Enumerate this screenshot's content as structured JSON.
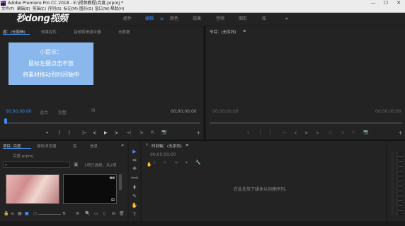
{
  "titlebar": {
    "app_icon_label": "Pr",
    "title": "Adobe Premiere Pro CC 2018 - E:\\视频教程\\百度.prproj *",
    "minimize": "—",
    "maximize": "☐",
    "close": "✕"
  },
  "menubar": {
    "items": [
      "文件(F)",
      "编辑(E)",
      "剪辑(C)",
      "序列(S)",
      "标记(M)",
      "图形(G)",
      "窗口(W)",
      "帮助(H)"
    ]
  },
  "workspace": {
    "tabs": [
      "组件",
      "编辑",
      "颜色",
      "效果",
      "音频",
      "图形",
      "库"
    ],
    "active_index": 1,
    "active_menu_glyph": "≡",
    "more": "»"
  },
  "logo": "秒dong视频",
  "source_panel": {
    "tabs": [
      "源：(无剪辑)",
      "效果控件",
      "音频剪辑混合器",
      "元数据"
    ],
    "timecode_left": "00;00;00;00",
    "fit_label": "适合",
    "fraction": "完整",
    "timecode_right": "00;00;00;00"
  },
  "tip": {
    "title": "小提示：",
    "line1": "鼠标左键点击不放",
    "line2": "将素材拖动到时间轴中"
  },
  "program_panel": {
    "tab": "节目：(无序列)",
    "menu_glyph": "≡",
    "timecode_left": "00;00;00;00",
    "timecode_right": "00;00;00;00"
  },
  "transport": {
    "buttons": [
      "▾",
      "{",
      "}",
      "|←",
      "◂|",
      "▶",
      "|▸",
      "→|",
      "⇲",
      "⇱",
      "📷"
    ],
    "add": "+"
  },
  "project_panel": {
    "tabs": [
      "项目: 百度",
      "媒体浏览器",
      "库",
      "信息"
    ],
    "more": "»",
    "project_file": "百度.prproj",
    "search_placeholder": "",
    "items_selected": "1项已选择，共2项"
  },
  "timeline_panel": {
    "close": "×",
    "tab": "时间轴：(无序列)",
    "menu_glyph": "≡",
    "timecode": "00;00;00;00",
    "empty_message": "在此处放下媒体以创建序列。"
  },
  "tools": [
    "▶",
    "⇹",
    "✥",
    "⟺",
    "⧫",
    "✎",
    "✋",
    "T"
  ],
  "project_footer": {
    "icons": [
      "🔒",
      "≡",
      "▦",
      "■",
      "○",
      "⇅",
      "≣",
      "🔍",
      "▭",
      "▯",
      "⊟",
      "🗑"
    ]
  },
  "colors": {
    "accent": "#3d8df0",
    "panel_bg": "#232323",
    "tip_bg": "#8ab8ec"
  }
}
